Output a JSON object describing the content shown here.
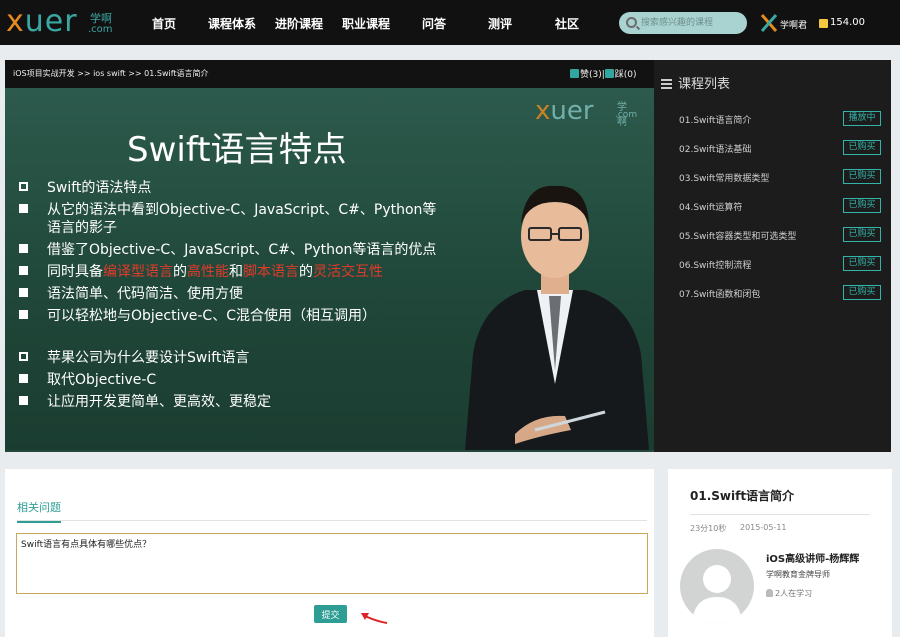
{
  "header": {
    "logo_text": "xuer",
    "logo_cn": "学啊",
    "logo_com": ".com",
    "nav": [
      "首页",
      "课程体系",
      "进阶课程",
      "职业课程",
      "问答",
      "测评",
      "社区"
    ],
    "search_placeholder": "搜索感兴趣的课程",
    "user_name": "学啊君",
    "coins": "154.00"
  },
  "player": {
    "breadcrumb": "iOS项目实战开发 >> ios swift >> 01.Swift语言简介",
    "likes": "赞(3)",
    "dislikes": "踩(0)",
    "slide_logo": "xuer",
    "slide_logo_cn": "学啊",
    "slide_logo_com": ".com",
    "slide_title": "Swift语言特点",
    "bullets": [
      "Swift的语法特点",
      "从它的语法中看到Objective-C、JavaScript、C#、Python等",
      "语言的影子",
      "借鉴了Objective-C、JavaScript、C#、Python等语言的优点",
      "同时具备",
      "编译型语言",
      "的",
      "高性能",
      "和",
      "脚本语言",
      "的",
      "灵活交互性",
      "语法简单、代码简洁、使用方便",
      "可以轻松地与Objective-C、C混合使用（相互调用）",
      "苹果公司为什么要设计Swift语言",
      "取代Objective-C",
      "让应用开发更简单、更高效、更稳定"
    ]
  },
  "courses": {
    "title": "课程列表",
    "items": [
      {
        "name": "01.Swift语言简介",
        "tag": "播放中"
      },
      {
        "name": "02.Swift语法基础",
        "tag": "已购买"
      },
      {
        "name": "03.Swift常用数据类型",
        "tag": "已购买"
      },
      {
        "name": "04.Swift运算符",
        "tag": "已购买"
      },
      {
        "name": "05.Swift容器类型和可选类型",
        "tag": "已购买"
      },
      {
        "name": "06.Swift控制流程",
        "tag": "已购买"
      },
      {
        "name": "07.Swift函数和闭包",
        "tag": "已购买"
      }
    ]
  },
  "qa": {
    "tab": "相关问题",
    "input_value": "Swift语言有点具体有哪些优点？",
    "submit": "提交"
  },
  "lesson": {
    "title": "01.Swift语言简介",
    "duration": "23分10秒",
    "date": "2015-05-11",
    "teacher": "iOS高级讲师-杨辉辉",
    "org": "学啊教育金牌导师",
    "learners": "2人在学习"
  }
}
